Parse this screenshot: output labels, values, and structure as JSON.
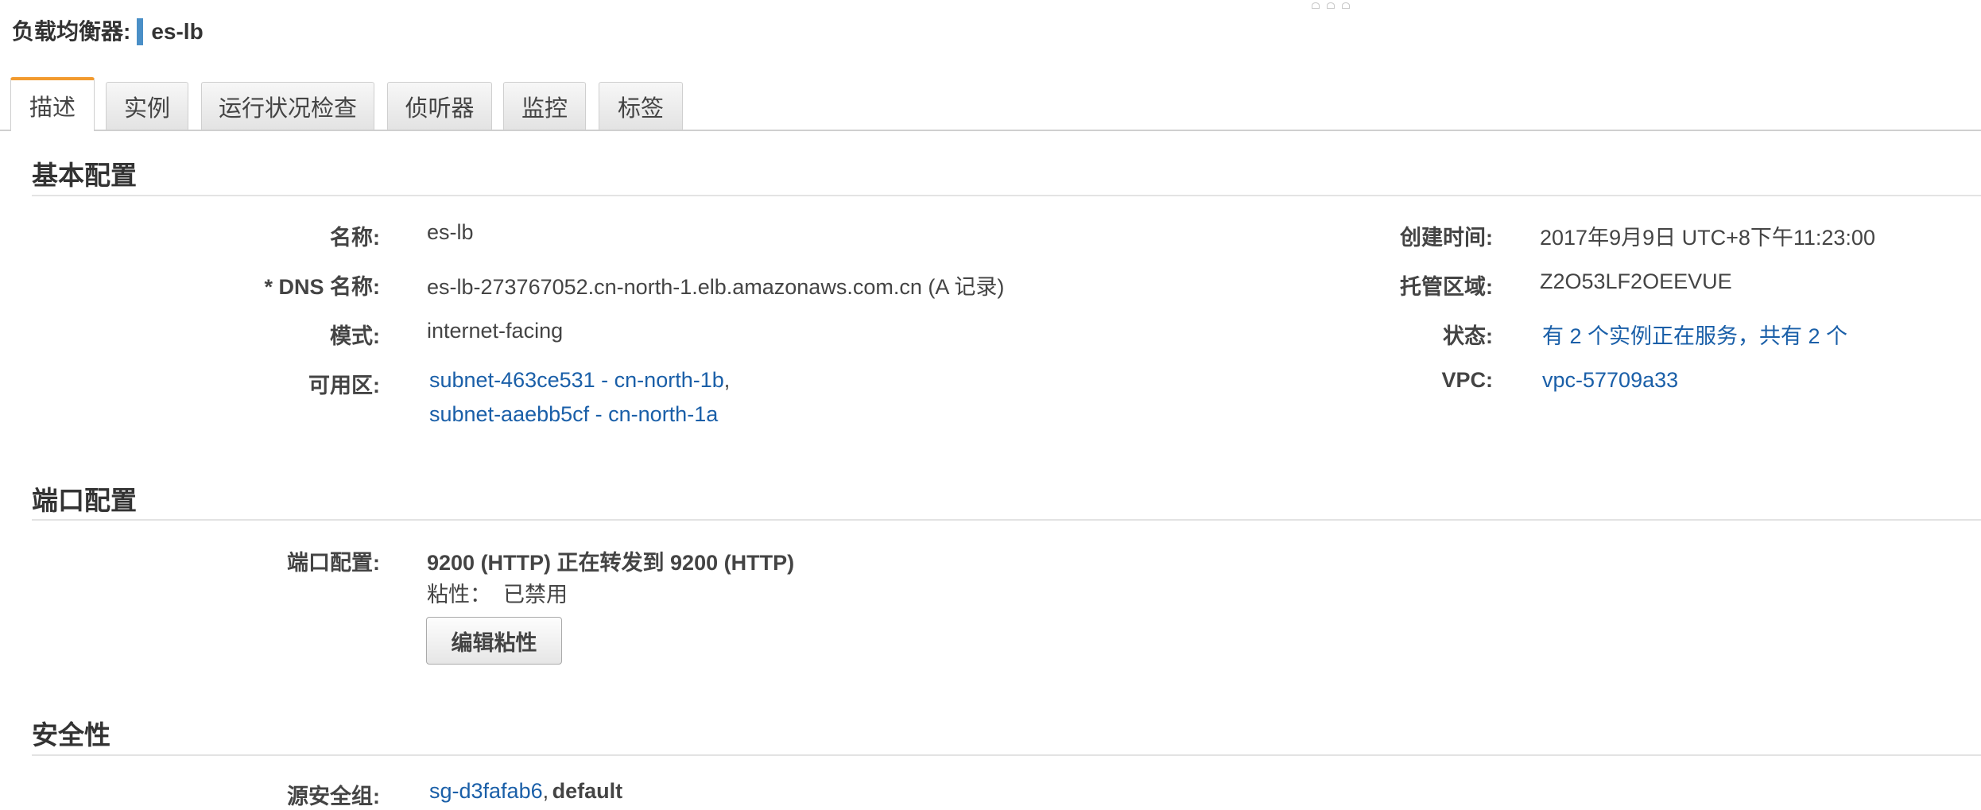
{
  "header": {
    "label": "负载均衡器:",
    "name": "es-lb"
  },
  "tabs": [
    {
      "label": "描述"
    },
    {
      "label": "实例"
    },
    {
      "label": "运行状况检查"
    },
    {
      "label": "侦听器"
    },
    {
      "label": "监控"
    },
    {
      "label": "标签"
    }
  ],
  "basic": {
    "title": "基本配置",
    "name_label": "名称:",
    "name_value": "es-lb",
    "dns_label": "* DNS 名称:",
    "dns_value": "es-lb-273767052.cn-north-1.elb.amazonaws.com.cn (A 记录)",
    "scheme_label": "模式:",
    "scheme_value": "internet-facing",
    "az_label": "可用区:",
    "az_links": [
      "subnet-463ce531 - cn-north-1b",
      "subnet-aaebb5cf - cn-north-1a"
    ],
    "az_sep": ",",
    "created_label": "创建时间:",
    "created_value": "2017年9月9日 UTC+8下午11:23:00",
    "zone_label": "托管区域:",
    "zone_value": "Z2O53LF2OEEVUE",
    "status_label": "状态:",
    "status_value": "有 2 个实例正在服务，共有 2 个",
    "vpc_label": "VPC:",
    "vpc_value": "vpc-57709a33"
  },
  "port": {
    "title": "端口配置",
    "label": "端口配置:",
    "value": "9200 (HTTP) 正在转发到 9200 (HTTP)",
    "stickiness": "粘性：  已禁用",
    "edit_button": "编辑粘性"
  },
  "security": {
    "title": "安全性",
    "label": "源安全组:",
    "sg_link": "sg-d3fafab6",
    "sg_sep": ",",
    "sg_name": "default"
  },
  "colors": {
    "link": "#1a5fa8",
    "active_tab_accent": "#f29a2e",
    "title_separator": "#4a8fc7"
  }
}
